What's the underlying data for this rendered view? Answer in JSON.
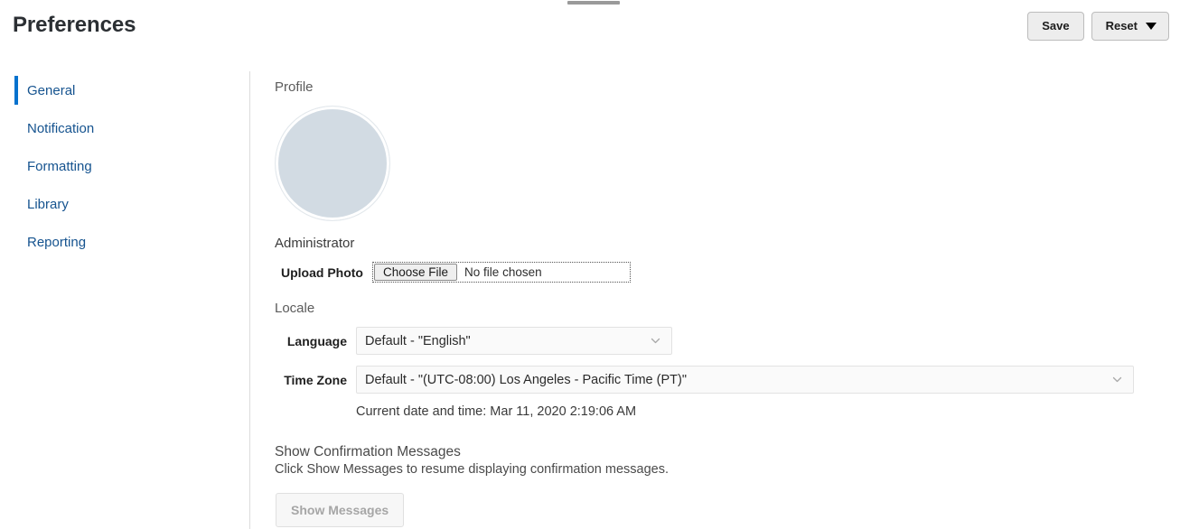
{
  "window": {
    "drag_handle": "drag-handle"
  },
  "header": {
    "title": "Preferences",
    "save_label": "Save",
    "reset_label": "Reset"
  },
  "sidebar": {
    "items": [
      {
        "label": "General",
        "selected": true
      },
      {
        "label": "Notification",
        "selected": false
      },
      {
        "label": "Formatting",
        "selected": false
      },
      {
        "label": "Library",
        "selected": false
      },
      {
        "label": "Reporting",
        "selected": false
      }
    ]
  },
  "main": {
    "profile": {
      "section_label": "Profile",
      "user_name": "Administrator",
      "upload_label": "Upload Photo",
      "choose_file_label": "Choose File",
      "file_status": "No file chosen"
    },
    "locale": {
      "section_label": "Locale",
      "language_label": "Language",
      "language_value": "Default - \"English\"",
      "timezone_label": "Time Zone",
      "timezone_value": "Default - \"(UTC-08:00) Los Angeles - Pacific Time (PT)\"",
      "current_datetime": "Current date and time: Mar 11, 2020 2:19:06 AM"
    },
    "confirmation": {
      "title": "Show Confirmation Messages",
      "description": "Click Show Messages to resume displaying confirmation messages.",
      "button_label": "Show Messages"
    }
  },
  "colors": {
    "accent_blue": "#0572ce",
    "link_blue": "#15538f",
    "avatar_fill": "#d2dbe3",
    "handle_gray": "#9a9a9a"
  }
}
